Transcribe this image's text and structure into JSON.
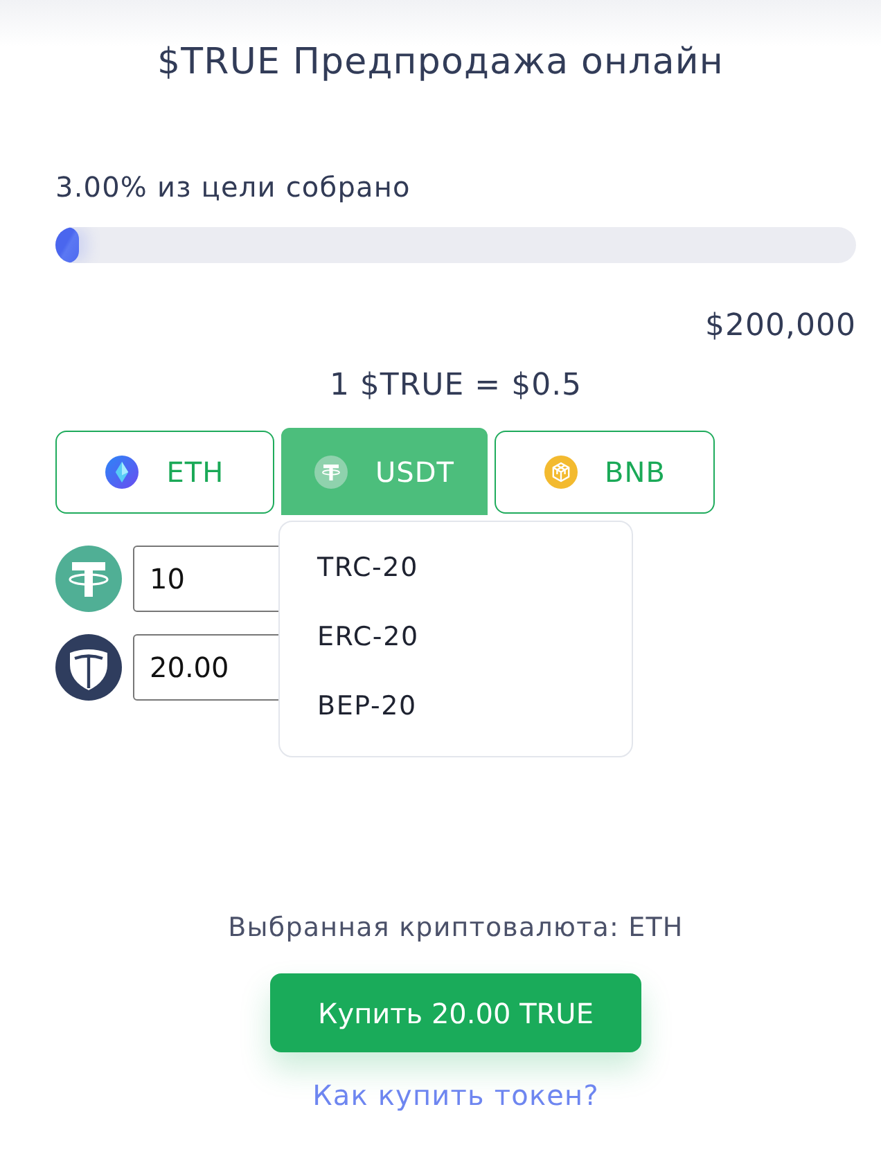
{
  "title": "$TRUE Предпродажа онлайн",
  "progress": {
    "label": "3.00% из цели собрано",
    "level": 0.03,
    "goal": "$200,000"
  },
  "rate": "1 $TRUE = $0.5",
  "currency_tabs": [
    {
      "label": "ETH",
      "kind": "eth",
      "selected": false
    },
    {
      "label": "USDT",
      "kind": "usdt",
      "selected": true
    },
    {
      "label": "BNB",
      "kind": "bnb",
      "selected": false
    }
  ],
  "network_menu": {
    "open": true,
    "items": [
      "TRC-20",
      "ERC-20",
      "BEP-20"
    ]
  },
  "amount_fields": [
    {
      "kind": "usdt",
      "value": "10"
    },
    {
      "kind": "true",
      "value": "20.00"
    }
  ],
  "selected_currency": "Выбранная криптовалюта: ETH",
  "buy_button": "Купить 20.00 TRUE",
  "help_link": "Как купить токен?"
}
